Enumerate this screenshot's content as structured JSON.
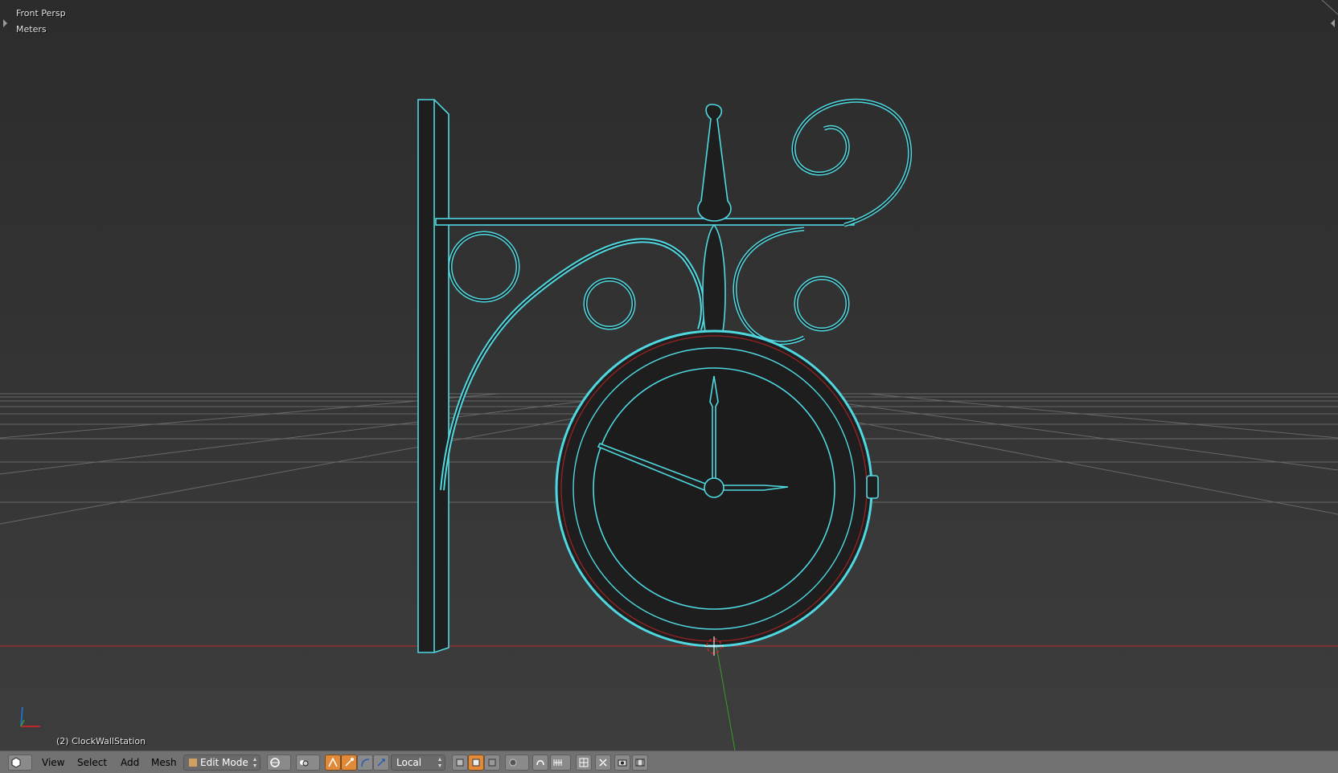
{
  "viewport": {
    "view_name": "Front Persp",
    "units": "Meters",
    "object_info": "(2) ClockWallStation"
  },
  "header": {
    "menus": [
      "View",
      "Select",
      "Add",
      "Mesh"
    ],
    "mode": "Edit Mode",
    "pivot": "Local",
    "icons": [
      "editor-type-icon",
      "viewport-shading-icon",
      "pivot-point-icon",
      "manipulator-icon",
      "vertex-select-icon",
      "edge-select-icon",
      "face-select-icon",
      "proportional-edit-icon",
      "snap-icon",
      "layers-icon",
      "render-icon"
    ]
  },
  "colors": {
    "wire": "#4fd8e0",
    "x_axis": "#c02828",
    "y_axis": "#3a9a2a",
    "header_bg": "#727272",
    "active_btn": "#e08a3a"
  }
}
